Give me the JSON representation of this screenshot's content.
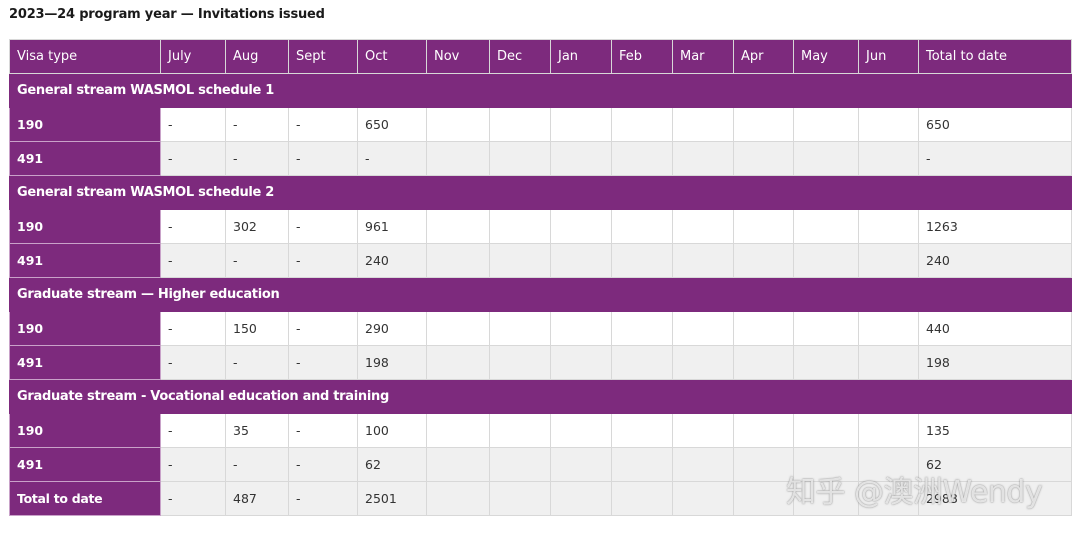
{
  "caption": "2023—24 program year — Invitations issued",
  "table": {
    "headers": [
      "Visa type",
      "July",
      "Aug",
      "Sept",
      "Oct",
      "Nov",
      "Dec",
      "Jan",
      "Feb",
      "Mar",
      "Apr",
      "May",
      "Jun",
      "Total to date"
    ],
    "sections": [
      {
        "title": "General stream WASMOL schedule 1",
        "rows": [
          {
            "visa": "190",
            "values": [
              "-",
              "-",
              "-",
              "650",
              "",
              "",
              "",
              "",
              "",
              "",
              "",
              ""
            ],
            "total": "650"
          },
          {
            "visa": "491",
            "values": [
              "-",
              "-",
              "-",
              "-",
              "",
              "",
              "",
              "",
              "",
              "",
              "",
              ""
            ],
            "total": "-"
          }
        ]
      },
      {
        "title": "General stream WASMOL schedule 2",
        "rows": [
          {
            "visa": "190",
            "values": [
              "-",
              "302",
              "-",
              "961",
              "",
              "",
              "",
              "",
              "",
              "",
              "",
              ""
            ],
            "total": "1263"
          },
          {
            "visa": "491",
            "values": [
              "-",
              "-",
              "-",
              "240",
              "",
              "",
              "",
              "",
              "",
              "",
              "",
              ""
            ],
            "total": "240"
          }
        ]
      },
      {
        "title": "Graduate stream — Higher education",
        "rows": [
          {
            "visa": "190",
            "values": [
              "-",
              "150",
              "-",
              "290",
              "",
              "",
              "",
              "",
              "",
              "",
              "",
              ""
            ],
            "total": "440"
          },
          {
            "visa": "491",
            "values": [
              "-",
              "-",
              "-",
              "198",
              "",
              "",
              "",
              "",
              "",
              "",
              "",
              ""
            ],
            "total": "198"
          }
        ]
      },
      {
        "title": "Graduate stream - Vocational education and training",
        "rows": [
          {
            "visa": "190",
            "values": [
              "-",
              "35",
              "-",
              "100",
              "",
              "",
              "",
              "",
              "",
              "",
              "",
              ""
            ],
            "total": "135"
          },
          {
            "visa": "491",
            "values": [
              "-",
              "-",
              "-",
              "62",
              "",
              "",
              "",
              "",
              "",
              "",
              "",
              ""
            ],
            "total": "62"
          }
        ]
      }
    ],
    "total_row": {
      "label": "Total to date",
      "values": [
        "-",
        "487",
        "-",
        "2501",
        "",
        "",
        "",
        "",
        "",
        "",
        "",
        ""
      ],
      "total": "2988"
    }
  },
  "watermark": "知乎 @澳洲Wendy",
  "colors": {
    "header_purple": "#7d2a7d",
    "stripe_gray": "#f0f0f0"
  }
}
